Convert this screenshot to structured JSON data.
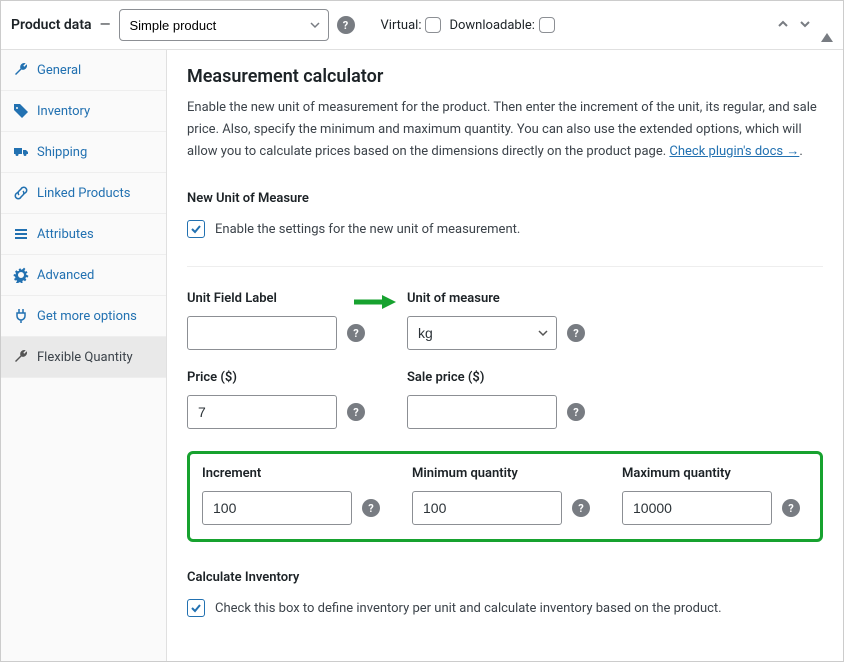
{
  "header": {
    "title": "Product data",
    "dash": "—",
    "product_type": "Simple product",
    "virtual_label": "Virtual:",
    "downloadable_label": "Downloadable:",
    "virtual_checked": false,
    "downloadable_checked": false
  },
  "tabs": {
    "items": [
      {
        "name": "general",
        "label": "General",
        "icon": "wrench-icon"
      },
      {
        "name": "inventory",
        "label": "Inventory",
        "icon": "tag-icon"
      },
      {
        "name": "shipping",
        "label": "Shipping",
        "icon": "truck-icon"
      },
      {
        "name": "linked",
        "label": "Linked Products",
        "icon": "link-icon"
      },
      {
        "name": "attributes",
        "label": "Attributes",
        "icon": "list-icon"
      },
      {
        "name": "advanced",
        "label": "Advanced",
        "icon": "gear-icon"
      },
      {
        "name": "more",
        "label": "Get more options",
        "icon": "plug-icon"
      },
      {
        "name": "flexible",
        "label": "Flexible Quantity",
        "icon": "wrench-icon"
      }
    ],
    "active": "flexible"
  },
  "main": {
    "title": "Measurement calculator",
    "description": "Enable the new unit of measurement for the product. Then enter the increment of the unit, its regular, and sale price. Also, specify the minimum and maximum quantity. You can also use the extended options, which will allow you to calculate prices based on the dimensions directly on the product page. ",
    "docs_link": "Check plugin's docs →",
    "new_unit_heading": "New Unit of Measure",
    "enable_label": "Enable the settings for the new unit of measurement.",
    "enable_checked": true,
    "fields": {
      "unit_field_label": {
        "label": "Unit Field Label",
        "value": ""
      },
      "unit_of_measure": {
        "label": "Unit of measure",
        "value": "kg"
      },
      "price": {
        "label": "Price ($)",
        "value": "7"
      },
      "sale_price": {
        "label": "Sale price ($)",
        "value": ""
      },
      "increment": {
        "label": "Increment",
        "value": "100"
      },
      "min_qty": {
        "label": "Minimum quantity",
        "value": "100"
      },
      "max_qty": {
        "label": "Maximum quantity",
        "value": "10000"
      }
    },
    "calc_inventory_heading": "Calculate Inventory",
    "calc_inventory_label": "Check this box to define inventory per unit and calculate inventory based on the product.",
    "calc_inventory_checked": true
  }
}
